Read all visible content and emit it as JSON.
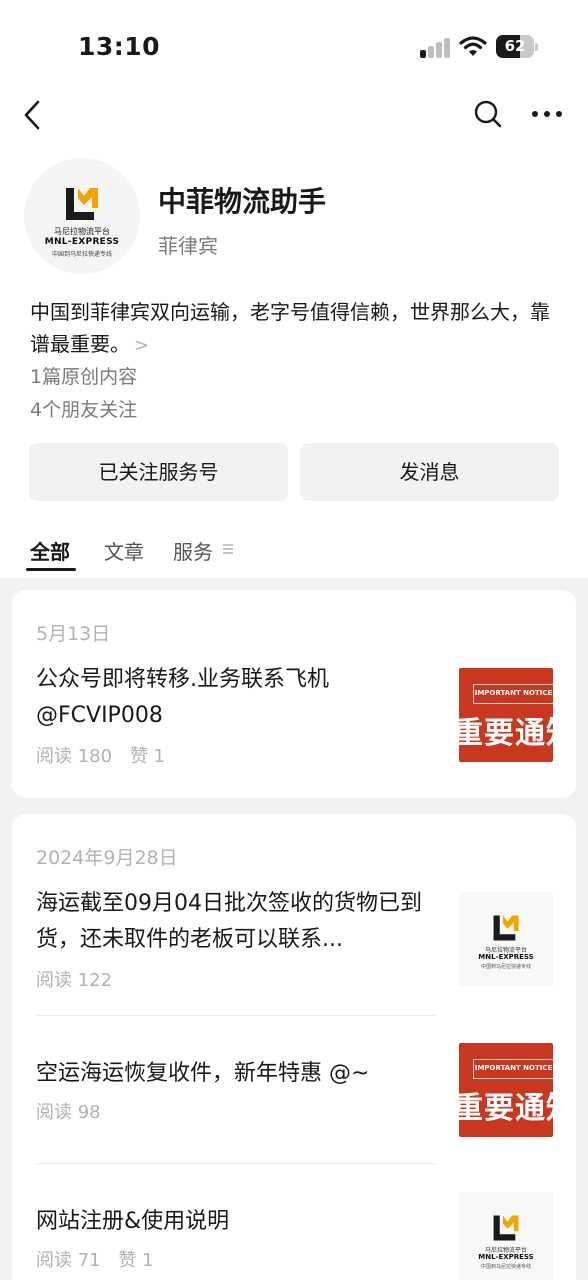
{
  "status_bar": {
    "time": "13:10",
    "battery": "62",
    "battery_level": 0.62
  },
  "account": {
    "name": "中菲物流助手",
    "region": "菲律宾",
    "description": "中国到菲律宾双向运输，老字号值得信赖，世界那么大，靠谱最重要。",
    "description_more": ">",
    "original_count": "1篇原创内容",
    "friends_following": "4个朋友关注",
    "logo": {
      "cn": "马尼拉物流平台",
      "en": "MNL-EXPRESS",
      "sub": "中国到马尼拉快递专线"
    }
  },
  "actions": {
    "followed": "已关注服务号",
    "message": "发消息"
  },
  "tabs": [
    {
      "label": "全部",
      "active": true
    },
    {
      "label": "文章",
      "active": false
    },
    {
      "label": "服务",
      "active": false
    }
  ],
  "thumbs": {
    "notice_small": "IMPORTANT NOTICE",
    "notice_big": "重要通知"
  },
  "feed": [
    {
      "date": "5月13日",
      "articles": [
        {
          "title": "公众号即将转移.业务联系飞机@FCVIP008",
          "reads": "阅读 180",
          "likes": "赞 1",
          "thumb": "notice"
        }
      ]
    },
    {
      "date": "2024年9月28日",
      "articles": [
        {
          "title": "海运截至09月04日批次签收的货物已到货，还未取件的老板可以联系...",
          "reads": "阅读 122",
          "likes": "",
          "thumb": "logo"
        },
        {
          "title": "空运海运恢复收件，新年特惠 @~",
          "reads": "阅读 98",
          "likes": "",
          "thumb": "notice"
        },
        {
          "title": "网站注册&使用说明",
          "reads": "阅读 71",
          "likes": "赞 1",
          "thumb": "logo"
        }
      ]
    }
  ]
}
